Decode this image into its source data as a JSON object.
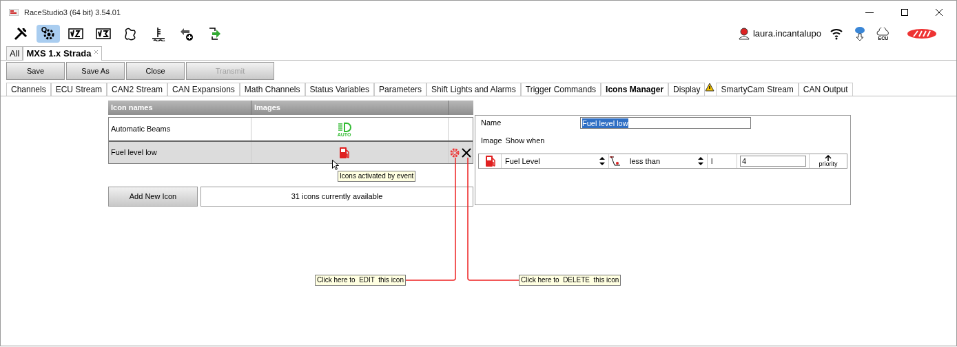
{
  "window": {
    "title": "RaceStudio3 (64 bit) 3.54.01"
  },
  "user": {
    "name": "laura.incantalupo",
    "ecu_label": "ECU"
  },
  "toolbar": [
    {
      "kind": "wrench",
      "selected": false
    },
    {
      "kind": "gears",
      "selected": true
    },
    {
      "kind": "v2",
      "selected": false
    },
    {
      "kind": "v3",
      "selected": false
    },
    {
      "kind": "track",
      "selected": false
    },
    {
      "kind": "gauge",
      "selected": false
    },
    {
      "kind": "add",
      "selected": false
    },
    {
      "kind": "sync",
      "selected": false
    }
  ],
  "device_tabs": [
    {
      "label": "All",
      "selected": false
    },
    {
      "label": "MXS 1.x Strada",
      "selected": true,
      "closable": true
    }
  ],
  "actions": [
    {
      "label": "Save",
      "disabled": false
    },
    {
      "label": "Save As",
      "disabled": false
    },
    {
      "label": "Close",
      "disabled": false
    },
    {
      "label": "Transmit",
      "disabled": true
    }
  ],
  "tabs": [
    {
      "label": "Channels",
      "selected": false,
      "warning": false
    },
    {
      "label": "ECU Stream",
      "selected": false,
      "warning": false
    },
    {
      "label": "CAN2 Stream",
      "selected": false,
      "warning": false
    },
    {
      "label": "CAN Expansions",
      "selected": false,
      "warning": false
    },
    {
      "label": "Math Channels",
      "selected": false,
      "warning": false
    },
    {
      "label": "Status Variables",
      "selected": false,
      "warning": false
    },
    {
      "label": "Parameters",
      "selected": false,
      "warning": false
    },
    {
      "label": "Shift Lights and Alarms",
      "selected": false,
      "warning": false
    },
    {
      "label": "Trigger Commands",
      "selected": false,
      "warning": false
    },
    {
      "label": "Icons Manager",
      "selected": true,
      "warning": false
    },
    {
      "label": "Display",
      "selected": false,
      "warning": false
    },
    {
      "label": "SmartyCam Stream",
      "selected": false,
      "warning": true
    },
    {
      "label": "CAN Output",
      "selected": false,
      "warning": false
    }
  ],
  "icons_table": {
    "columns": [
      "Icon names",
      "Images"
    ],
    "rows": [
      {
        "name": "Automatic Beams",
        "kind": "headlight",
        "auto_label": "AUTO",
        "selected": false
      },
      {
        "name": "Fuel level low",
        "kind": "fuel",
        "selected": true
      }
    ]
  },
  "add_button": "Add New Icon",
  "available": "31 icons currently available",
  "tooltip": "Icons activated by event",
  "editor": {
    "name_label": "Name",
    "name_value": "Fuel level low",
    "image_label": "Image",
    "show_when_label": "Show when",
    "condition": {
      "kind": "fuel",
      "channel": "Fuel Level",
      "operator": "less than",
      "unit": "l",
      "value": "4",
      "priority_label": "priority"
    }
  },
  "callouts": [
    {
      "kind": "edit",
      "text": "Click here to  EDIT  this icon"
    },
    {
      "kind": "delete",
      "text": "Click here to  DELETE  this icon"
    }
  ]
}
